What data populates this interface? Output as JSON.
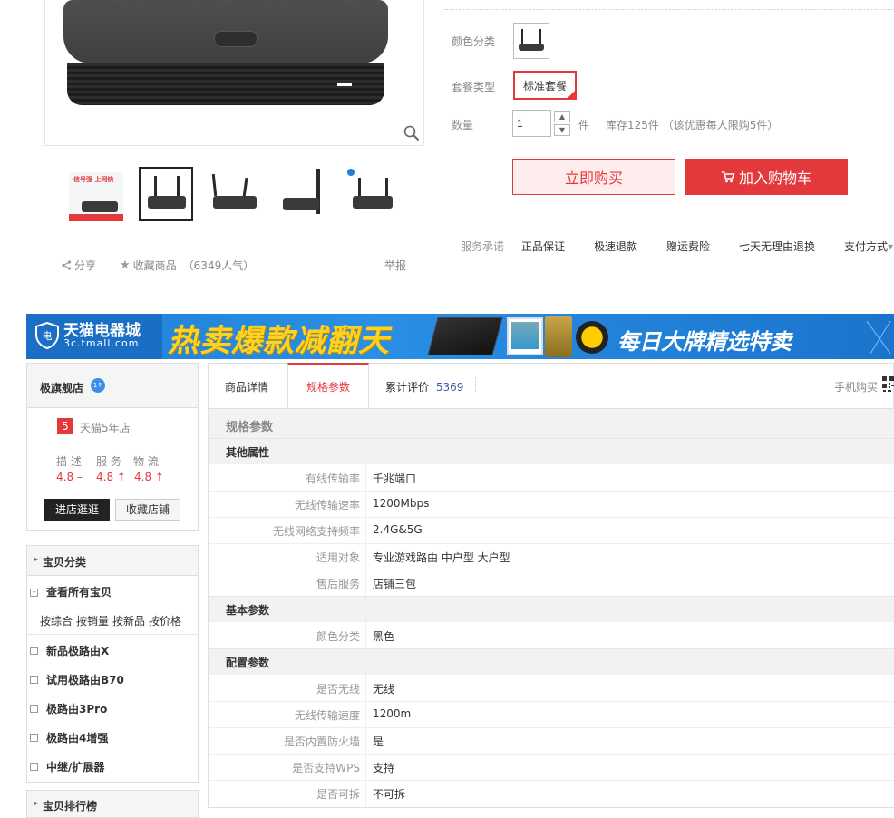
{
  "gallery": {
    "zoom_icon": "magnifier-icon",
    "thumb_promo_text": "信号强 上网快"
  },
  "actions": {
    "share": "分享",
    "favorite": "收藏商品",
    "popularity": "（6349人气）",
    "report": "举报"
  },
  "buy": {
    "color_label": "颜色分类",
    "package_label": "套餐类型",
    "package_value": "标准套餐",
    "qty_label": "数量",
    "qty_value": "1",
    "qty_unit": "件",
    "stock": "库存125件 （该优惠每人限购5件）",
    "buy_now": "立即购买",
    "add_cart": "加入购物车",
    "service_label": "服务承诺",
    "services": [
      "正品保证",
      "极速退款",
      "赠运费险",
      "七天无理由退换"
    ],
    "payment_label": "支付方式"
  },
  "banner": {
    "logo_name": "天猫电器城",
    "logo_url": "3c.tmall.com",
    "headline": "热卖爆款减翻天",
    "subline": "每日大牌精选特卖"
  },
  "shop": {
    "name": "极旗舰店",
    "years_badge": "5",
    "years_text": "天猫5年店",
    "rating_headers": [
      "描 述",
      "服 务",
      "物 流"
    ],
    "ratings": [
      "4.8 –",
      "4.8 ↑",
      "4.8 ↑"
    ],
    "enter_btn": "进店逛逛",
    "fav_btn": "收藏店铺"
  },
  "categories": {
    "title": "宝贝分类",
    "all_items": "查看所有宝贝",
    "sorts": [
      "按综合",
      "按销量",
      "按新品",
      "按价格"
    ],
    "items": [
      "新品极路由X",
      "试用极路由B70",
      "极路由3Pro",
      "极路由4增强",
      "中继/扩展器"
    ],
    "ranking_title": "宝贝排行榜"
  },
  "tabs": {
    "detail": "商品详情",
    "specs": "规格参数",
    "reviews_label": "累计评价",
    "reviews_count": "5369",
    "mobile_buy": "手机购买"
  },
  "specs": {
    "heading": "规格参数",
    "sections": [
      {
        "title": "其他属性",
        "rows": [
          {
            "k": "有线传输率",
            "v": "千兆端口"
          },
          {
            "k": "无线传输速率",
            "v": "1200Mbps"
          },
          {
            "k": "无线网络支持频率",
            "v": "2.4G&5G"
          },
          {
            "k": "适用对象",
            "v": "专业游戏路由 中户型 大户型"
          },
          {
            "k": "售后服务",
            "v": "店铺三包"
          }
        ]
      },
      {
        "title": "基本参数",
        "rows": [
          {
            "k": "颜色分类",
            "v": "黑色"
          }
        ]
      },
      {
        "title": "配置参数",
        "rows": [
          {
            "k": "是否无线",
            "v": "无线"
          },
          {
            "k": "无线传输速度",
            "v": "1200m"
          },
          {
            "k": "是否内置防火墙",
            "v": "是"
          },
          {
            "k": "是否支持WPS",
            "v": "支持"
          },
          {
            "k": "是否可拆",
            "v": "不可拆"
          }
        ]
      }
    ]
  },
  "colors": {
    "accent": "#e4393c",
    "banner_blue": "#1f7fd6",
    "banner_yellow": "#ffd21f"
  }
}
